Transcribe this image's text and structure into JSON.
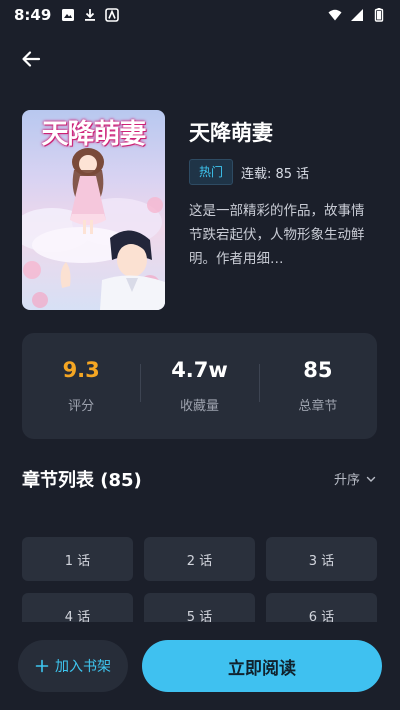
{
  "status_bar": {
    "time": "8:49",
    "icons_left": [
      "image-icon",
      "download-icon",
      "app-icon"
    ],
    "icons_right": [
      "wifi-icon",
      "signal-icon",
      "battery-icon"
    ]
  },
  "nav": {
    "back_icon": "arrow-left-icon"
  },
  "book": {
    "cover_title": "天降萌妻",
    "title": "天降萌妻",
    "badge": "热门",
    "serial_info": "连载: 85 话",
    "description": "这是一部精彩的作品，故事情节跌宕起伏，人物形象生动鲜明。作者用细…"
  },
  "stats": [
    {
      "value": "9.3",
      "label": "评分"
    },
    {
      "value": "4.7w",
      "label": "收藏量"
    },
    {
      "value": "85",
      "label": "总章节"
    }
  ],
  "chapters": {
    "title": "章节列表 (85)",
    "sort_label": "升序",
    "items": [
      "1 话",
      "2 话",
      "3 话",
      "4 话",
      "5 话",
      "6 话"
    ]
  },
  "actions": {
    "shelf_label": "加入书架",
    "read_label": "立即阅读"
  },
  "colors": {
    "background": "#1b1f2a",
    "card": "#272d39",
    "accent": "#3fc1f0",
    "rating": "#f5a623"
  }
}
